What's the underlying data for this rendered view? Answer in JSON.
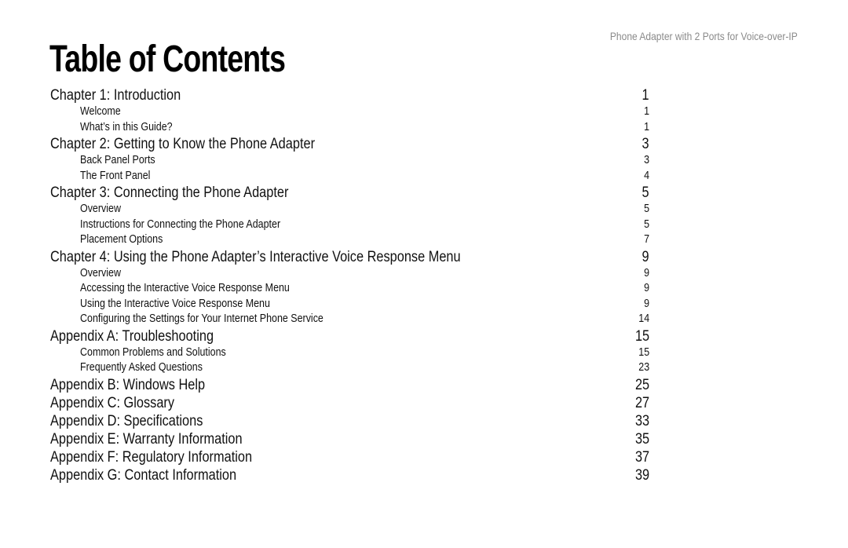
{
  "header": {
    "product_name": "Phone Adapter with 2 Ports for Voice-over-IP"
  },
  "title": "Table of Contents",
  "toc": [
    {
      "label": "Chapter 1: Introduction",
      "page": "1",
      "level": 1
    },
    {
      "label": "Welcome",
      "page": "1",
      "level": 2
    },
    {
      "label": "What’s in this Guide?",
      "page": "1",
      "level": 2
    },
    {
      "label": "Chapter 2: Getting to Know the Phone Adapter",
      "page": "3",
      "level": 1
    },
    {
      "label": "Back Panel Ports",
      "page": "3",
      "level": 2
    },
    {
      "label": "The Front Panel",
      "page": "4",
      "level": 2
    },
    {
      "label": "Chapter 3: Connecting the Phone Adapter",
      "page": "5",
      "level": 1
    },
    {
      "label": "Overview",
      "page": "5",
      "level": 2
    },
    {
      "label": "Instructions for Connecting the Phone Adapter",
      "page": "5",
      "level": 2
    },
    {
      "label": "Placement Options",
      "page": "7",
      "level": 2
    },
    {
      "label": "Chapter 4: Using the Phone Adapter’s Interactive Voice Response Menu",
      "page": "9",
      "level": 1
    },
    {
      "label": "Overview",
      "page": "9",
      "level": 2
    },
    {
      "label": "Accessing the Interactive Voice Response Menu",
      "page": "9",
      "level": 2
    },
    {
      "label": "Using the Interactive Voice Response Menu",
      "page": "9",
      "level": 2
    },
    {
      "label": "Configuring the Settings for Your Internet Phone Service",
      "page": "14",
      "level": 2
    },
    {
      "label": "Appendix A: Troubleshooting",
      "page": "15",
      "level": 1
    },
    {
      "label": "Common Problems and Solutions",
      "page": "15",
      "level": 2
    },
    {
      "label": "Frequently Asked Questions",
      "page": "23",
      "level": 2
    },
    {
      "label": "Appendix B: Windows Help",
      "page": "25",
      "level": 1
    },
    {
      "label": "Appendix C: Glossary",
      "page": "27",
      "level": 1
    },
    {
      "label": "Appendix D: Specifications",
      "page": "33",
      "level": 1
    },
    {
      "label": "Appendix E: Warranty Information",
      "page": "35",
      "level": 1
    },
    {
      "label": "Appendix F: Regulatory Information",
      "page": "37",
      "level": 1
    },
    {
      "label": "Appendix G: Contact Information",
      "page": "39",
      "level": 1
    }
  ]
}
